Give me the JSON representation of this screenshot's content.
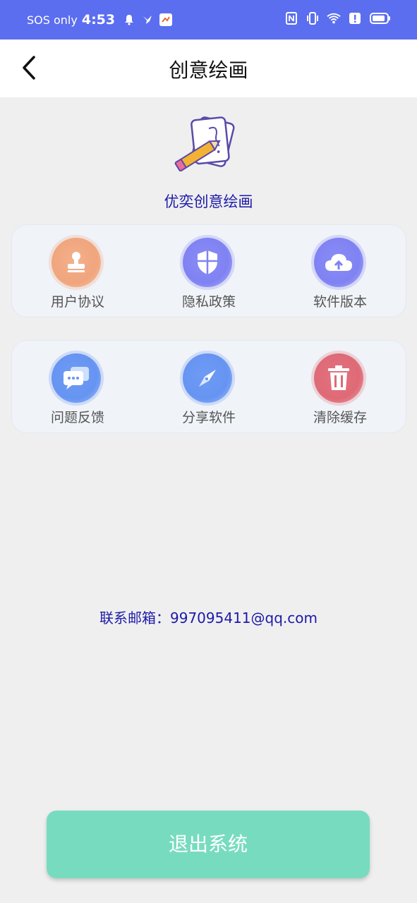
{
  "status_bar": {
    "carrier": "SOS only",
    "time": "4:53",
    "left_icons": [
      "bell-icon",
      "bird-icon",
      "app-notify-icon"
    ],
    "right_icons": [
      "nfc-icon",
      "vibrate-icon",
      "wifi-icon",
      "alert-icon",
      "battery-icon"
    ]
  },
  "header": {
    "title": "创意绘画",
    "back_icon": "chevron-left-icon"
  },
  "app": {
    "name": "优奕创意绘画",
    "logo_icon": "pencil-paper-icon"
  },
  "menu_row1": [
    {
      "label": "用户协议",
      "icon": "stamp-icon",
      "color": "#f0a57d"
    },
    {
      "label": "隐私政策",
      "icon": "shield-icon",
      "color": "#7f82f2"
    },
    {
      "label": "软件版本",
      "icon": "cloud-upload-icon",
      "color": "#7f82f2"
    }
  ],
  "menu_row2": [
    {
      "label": "问题反馈",
      "icon": "chat-bubble-icon",
      "color": "#6694f2"
    },
    {
      "label": "分享软件",
      "icon": "compass-icon",
      "color": "#6694f2"
    },
    {
      "label": "清除缓存",
      "icon": "trash-icon",
      "color": "#de6a76"
    }
  ],
  "contact": {
    "text": "联系邮箱：997095411@qq.com"
  },
  "footer": {
    "exit_label": "退出系统",
    "exit_color": "#77dcbf"
  },
  "colors": {
    "status_bar": "#5b6ef0",
    "accent_text": "#1d1aa8"
  }
}
